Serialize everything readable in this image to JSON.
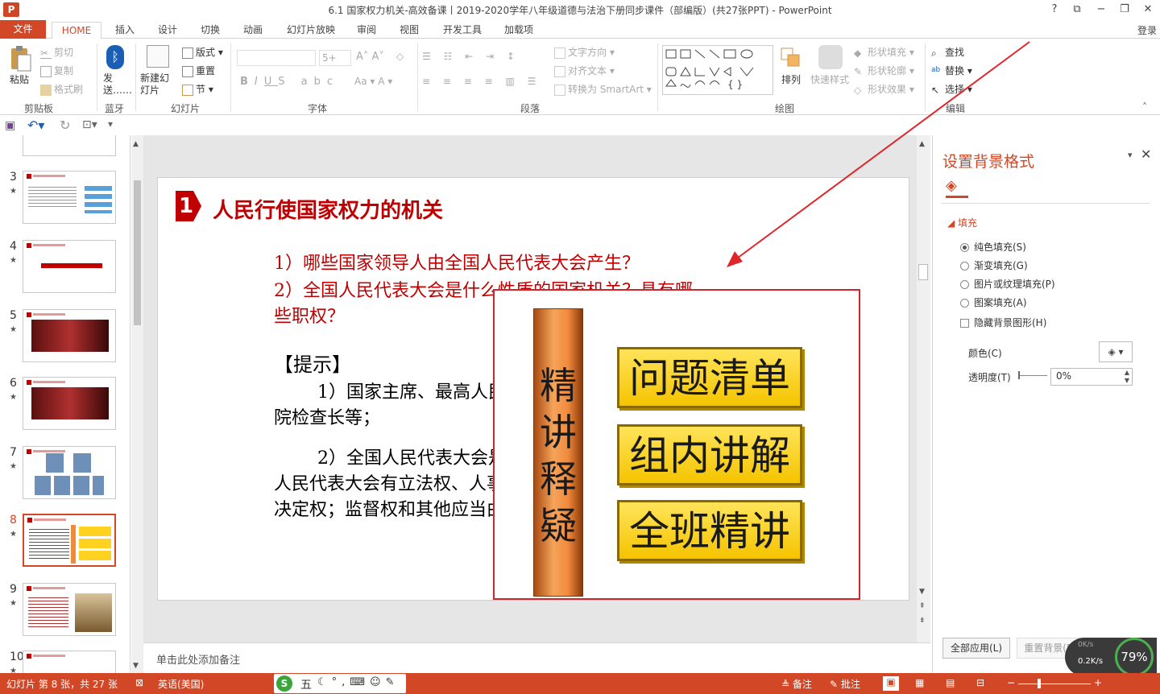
{
  "window": {
    "title": "6.1 国家权力机关-高效备课丨2019-2020学年八年级道德与法治下册同步课件（部编版）(共27张PPT) - PowerPoint",
    "controls": [
      "?",
      "⧉",
      "−",
      "❐",
      "✕"
    ],
    "app_letter": "P"
  },
  "tabs": {
    "file": "文件",
    "home": "HOME",
    "insert": "插入",
    "design": "设计",
    "transitions": "切换",
    "animations": "动画",
    "slideshow": "幻灯片放映",
    "review": "审阅",
    "view": "视图",
    "developer": "开发工具",
    "addins": "加载项",
    "login": "登录"
  },
  "ribbon": {
    "clipboard": {
      "paste": "粘贴",
      "cut": "剪切",
      "copy": "复制",
      "format_painter": "格式刷",
      "label": "剪贴板"
    },
    "bluetooth": {
      "send": "发送……",
      "label": "蓝牙"
    },
    "slides": {
      "new_slide": "新建幻灯片",
      "layout": "版式",
      "reset": "重置",
      "section": "节",
      "label": "幻灯片"
    },
    "font": {
      "size": "5+",
      "label": "字体"
    },
    "paragraph": {
      "text_direction": "文字方向",
      "align_text": "对齐文本",
      "smartart": "转换为 SmartArt",
      "label": "段落"
    },
    "drawing": {
      "arrange": "排列",
      "quick_styles": "快速样式",
      "shape_fill": "形状填充",
      "shape_outline": "形状轮廓",
      "shape_effects": "形状效果",
      "label": "绘图"
    },
    "editing": {
      "find": "查找",
      "replace": "替换",
      "select": "选择",
      "label": "编辑"
    }
  },
  "thumbnails": [
    {
      "num": "3",
      "star": "★"
    },
    {
      "num": "4",
      "star": "★"
    },
    {
      "num": "5",
      "star": "★"
    },
    {
      "num": "6",
      "star": "★"
    },
    {
      "num": "7",
      "star": "★"
    },
    {
      "num": "8",
      "star": "★"
    },
    {
      "num": "9",
      "star": "★"
    },
    {
      "num": "10",
      "star": "★"
    }
  ],
  "slide": {
    "badge": "1",
    "title": "人民行使国家权力的机关",
    "q1": "1）哪些国家领导人由全国人民代表大会产生？",
    "q2a": "2）全国人民代表大会是什么性质的国家机关？具有哪",
    "q2b": "些职权？",
    "hint": "【提示】",
    "a1a": "1）国家主席、最高人民法院院",
    "a1b": "院检查长等；",
    "a2a": "2）全国人民代表大会是最高国",
    "a2b": "人民代表大会有立法权、人事任免权、国家重大事项",
    "a2c": "决定权；监督权和其他应当由它行使",
    "pillar": [
      "精",
      "讲",
      "释",
      "疑"
    ],
    "boxes": [
      "问题清单",
      "组内讲解",
      "全班精讲"
    ]
  },
  "notes": {
    "placeholder": "单击此处添加备注"
  },
  "pane": {
    "title": "设置背景格式",
    "section": "填充",
    "options": [
      "纯色填充(S)",
      "渐变填充(G)",
      "图片或纹理填充(P)",
      "图案填充(A)"
    ],
    "hide_bg": "隐藏背景图形(H)",
    "color_label": "颜色(C)",
    "transparency_label": "透明度(T)",
    "transparency_value": "0%",
    "apply_all": "全部应用(L)",
    "reset_bg": "重置背景(B)"
  },
  "statusbar": {
    "slide_info": "幻灯片 第 8 张，共 27 张",
    "language": "英语(美国)",
    "notes": "备注",
    "comments": "批注",
    "zoom": "79%",
    "net_up": "0K/s",
    "net_down": "0.2K/s",
    "ime": "五"
  },
  "colors": {
    "accent": "#d24726",
    "slide_red": "#c00000",
    "box_yellow": "#ffd21f",
    "pillar_orange": "#f28a3c"
  }
}
